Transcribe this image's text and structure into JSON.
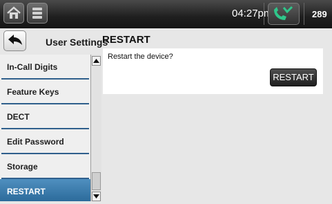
{
  "status_bar": {
    "time": "04:27pm",
    "extension": "289",
    "icons": [
      "home-icon",
      "menu-icon",
      "phone-icon"
    ]
  },
  "header": {
    "section_title": "User Settings",
    "page_title": "RESTART"
  },
  "sidebar": {
    "items": [
      {
        "label": "In-Call Digits"
      },
      {
        "label": "Feature Keys"
      },
      {
        "label": "DECT"
      },
      {
        "label": "Edit Password"
      },
      {
        "label": "Storage"
      },
      {
        "label": "RESTART",
        "selected": true
      }
    ]
  },
  "content": {
    "prompt": "Restart the device?",
    "button_label": "RESTART"
  },
  "colors": {
    "selected_item": "#2c6b9b",
    "phone_icon": "#2fc68a"
  }
}
